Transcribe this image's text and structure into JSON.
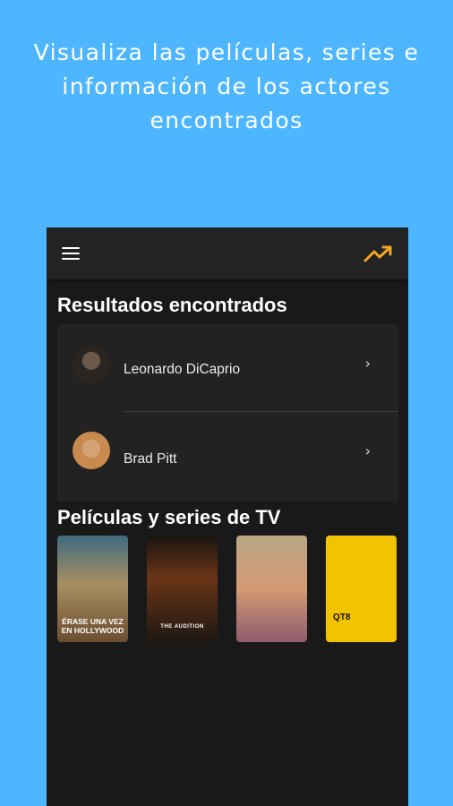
{
  "promo": {
    "title_line1": "Visualiza las películas, series e",
    "title_line2": "información de los actores",
    "title_line3": "encontrados"
  },
  "appbar": {
    "menu_icon": "menu-icon",
    "trending_icon": "trending-up-icon",
    "accent_color": "#f5a623"
  },
  "results": {
    "title": "Resultados encontrados",
    "people": [
      {
        "name": "Leonardo DiCaprio",
        "icon": "chevron-right-icon"
      },
      {
        "name": "Brad Pitt",
        "icon": "chevron-right-icon"
      }
    ],
    "chevron": "›"
  },
  "media": {
    "title": "Películas y series de TV",
    "posters": [
      {
        "caption": "ÉRASE UNA VEZ EN HOLLYWOOD"
      },
      {
        "caption": "THE AUDITION"
      },
      {
        "caption": ""
      },
      {
        "caption": "QT8"
      }
    ]
  },
  "colors": {
    "background": "#4db6ff",
    "app_background": "#191919",
    "card_background": "#222222"
  }
}
